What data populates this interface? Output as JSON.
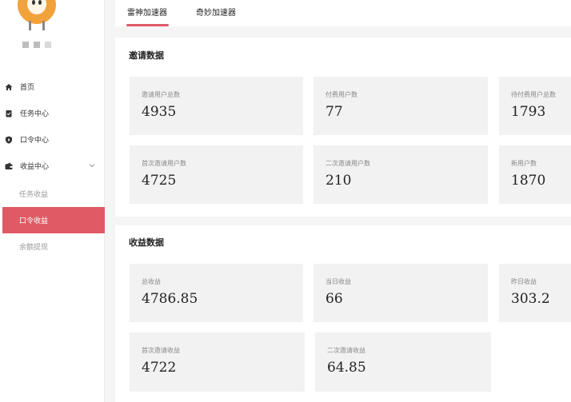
{
  "user": {
    "name_masked": "■ ■ ■"
  },
  "sidebar": {
    "items": [
      {
        "label": "首页",
        "icon": "home-icon"
      },
      {
        "label": "任务中心",
        "icon": "task-icon"
      },
      {
        "label": "口令中心",
        "icon": "shield-icon"
      },
      {
        "label": "收益中心",
        "icon": "wallet-icon"
      }
    ],
    "sub_items": [
      {
        "label": "任务收益"
      },
      {
        "label": "口令收益"
      },
      {
        "label": "余额提现"
      }
    ]
  },
  "tabs": [
    {
      "label": "雷神加速器"
    },
    {
      "label": "奇妙加速器"
    }
  ],
  "invite": {
    "title": "邀请数据",
    "cards": [
      {
        "label": "邀请用户总数",
        "value": "4935"
      },
      {
        "label": "付费用户数",
        "value": "77"
      },
      {
        "label": "待付费用户总数",
        "value": "1793"
      },
      {
        "label": "首次邀请用户数",
        "value": "4725"
      },
      {
        "label": "二次邀请用户数",
        "value": "210"
      },
      {
        "label": "新用户数",
        "value": "1870"
      }
    ]
  },
  "income": {
    "title": "收益数据",
    "cards": [
      {
        "label": "总收益",
        "value": "4786.85"
      },
      {
        "label": "当日收益",
        "value": "66"
      },
      {
        "label": "昨日收益",
        "value": "303.2"
      },
      {
        "label": "首次邀请收益",
        "value": "4722"
      },
      {
        "label": "二次邀请收益",
        "value": "64.85"
      }
    ]
  },
  "colors": {
    "accent": "#e05a66",
    "card_bg": "#f2f2f2"
  }
}
